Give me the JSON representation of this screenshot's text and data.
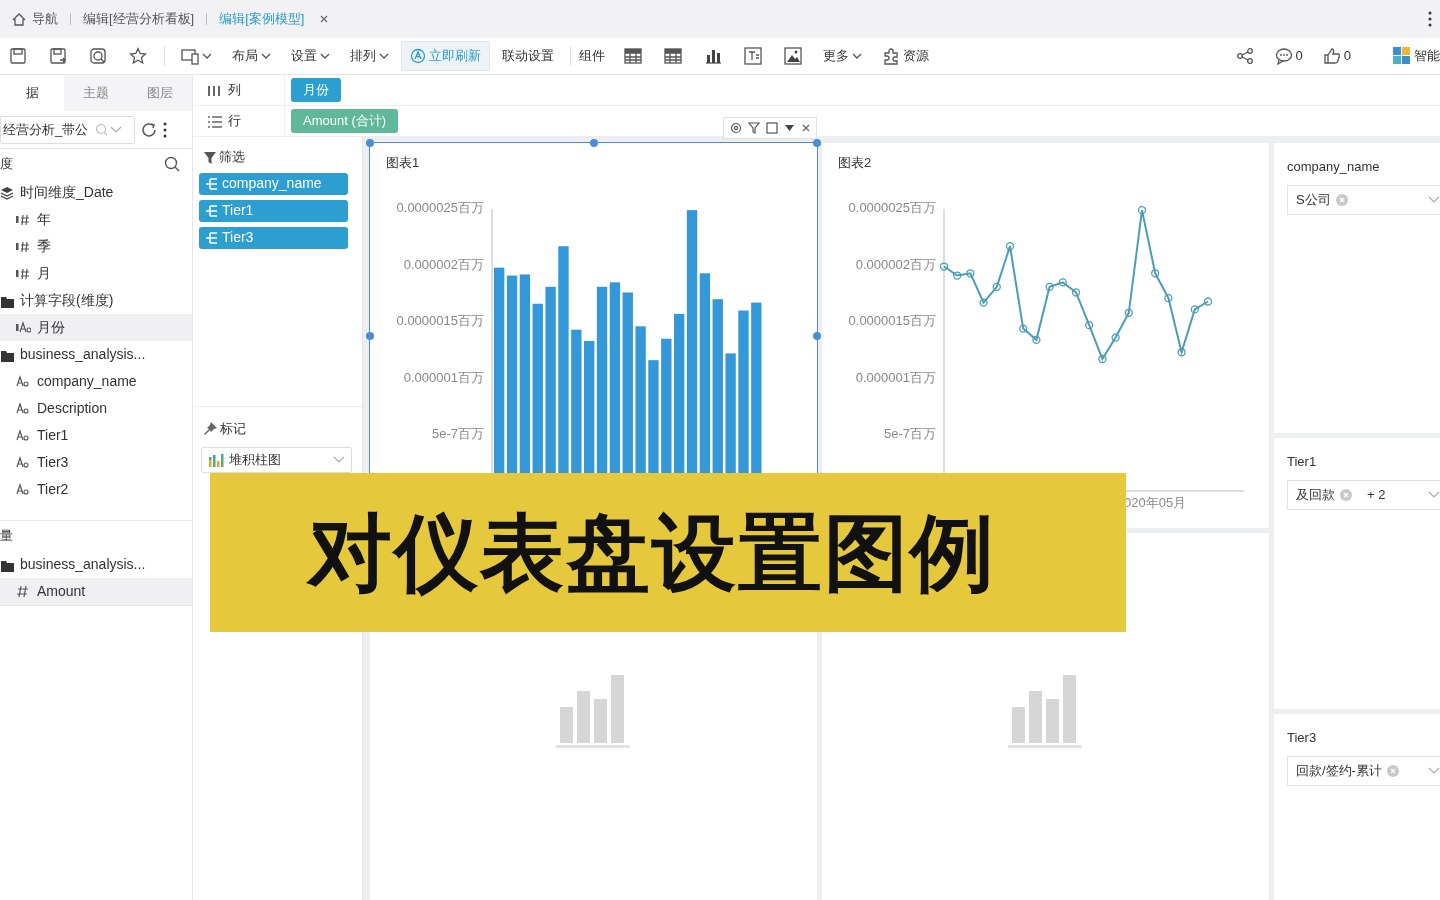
{
  "tabs": [
    {
      "label": "导航",
      "kind": "home",
      "selected": false,
      "closable": false
    },
    {
      "label": "编辑[经营分析看板]",
      "kind": "page",
      "selected": false,
      "closable": false
    },
    {
      "label": "编辑[案例模型]",
      "kind": "page",
      "selected": true,
      "closable": true
    }
  ],
  "toolbar": {
    "menus": [
      "布局",
      "设置",
      "排列"
    ],
    "refresh_button": "立即刷新",
    "link_settings": "联动设置",
    "components_label": "组件",
    "more_menu": "更多",
    "resources": "资源",
    "comments_count": "0",
    "likes_count": "0",
    "smart_label": "智能"
  },
  "left_panel": {
    "tabs": [
      {
        "label": "据",
        "selected": true
      },
      {
        "label": "主题",
        "selected": false
      },
      {
        "label": "图层",
        "selected": false
      }
    ],
    "search_value": "经营分析_带公",
    "sections": [
      {
        "title": "度",
        "tree": [
          {
            "label": "时间维度_Date",
            "kind": "hierarchy",
            "selected": false,
            "children": [
              {
                "label": "年",
                "kind": "date",
                "selected": false
              },
              {
                "label": "季",
                "kind": "date",
                "selected": false
              },
              {
                "label": "月",
                "kind": "date",
                "selected": false
              }
            ]
          },
          {
            "label": "计算字段(维度)",
            "kind": "folder",
            "selected": false,
            "children": [
              {
                "label": "月份",
                "kind": "calc",
                "selected": true
              }
            ]
          },
          {
            "label": "business_analysis...",
            "kind": "folder",
            "selected": false,
            "children": [
              {
                "label": "company_name",
                "kind": "text",
                "selected": false
              },
              {
                "label": "Description",
                "kind": "text",
                "selected": false
              },
              {
                "label": "Tier1",
                "kind": "text",
                "selected": false
              },
              {
                "label": "Tier3",
                "kind": "text",
                "selected": false
              },
              {
                "label": "Tier2",
                "kind": "text",
                "selected": false
              }
            ]
          }
        ]
      },
      {
        "title": "量",
        "tree": [
          {
            "label": "business_analysis...",
            "kind": "folder",
            "selected": false,
            "children": [
              {
                "label": "Amount",
                "kind": "number",
                "selected": true
              }
            ]
          }
        ]
      }
    ]
  },
  "shelves": [
    {
      "label": "列",
      "kind": "columns",
      "pills": [
        {
          "label": "月份",
          "kind": "dimension"
        }
      ]
    },
    {
      "label": "行",
      "kind": "rows",
      "pills": [
        {
          "label": "Amount (合计)",
          "kind": "measure"
        }
      ]
    }
  ],
  "filters": {
    "title": "筛选",
    "pills": [
      "company_name",
      "Tier1",
      "Tier3"
    ]
  },
  "marks": {
    "title": "标记",
    "chart_type": "堆积柱图"
  },
  "charts": [
    {
      "title": "图表1",
      "selected": true,
      "chart_data": {
        "type": "bar",
        "ylim": [
          0,
          2.5e-06
        ],
        "yticks": [
          {
            "value": 5e-07,
            "label": "5e-7百万"
          },
          {
            "value": 1e-06,
            "label": "0.000001百万"
          },
          {
            "value": 1.5e-06,
            "label": "0.0000015百万"
          },
          {
            "value": 2e-06,
            "label": "0.000002百万"
          },
          {
            "value": 2.5e-06,
            "label": "0.0000025百万"
          }
        ],
        "series": [
          {
            "color": "#3498d8",
            "values": [
              1.98e-06,
              1.91e-06,
              1.92e-06,
              1.66e-06,
              1.81e-06,
              2.17e-06,
              1.43e-06,
              1.33e-06,
              1.81e-06,
              1.85e-06,
              1.76e-06,
              1.46e-06,
              1.16e-06,
              1.35e-06,
              1.57e-06,
              2.49e-06,
              1.93e-06,
              1.7e-06,
              1.22e-06,
              1.6e-06,
              1.67e-06
            ]
          }
        ]
      }
    },
    {
      "title": "图表2",
      "selected": false,
      "axis_text": "020年05月",
      "chart_data": {
        "type": "line",
        "ylim": [
          0,
          2.5e-06
        ],
        "yticks": [
          {
            "value": 5e-07,
            "label": "5e-7百万"
          },
          {
            "value": 1e-06,
            "label": "0.000001百万"
          },
          {
            "value": 1.5e-06,
            "label": "0.0000015百万"
          },
          {
            "value": 2e-06,
            "label": "0.000002百万"
          },
          {
            "value": 2.5e-06,
            "label": "0.0000025百万"
          }
        ],
        "series": [
          {
            "color": "#4a9db5",
            "marker": "circle",
            "values": [
              1.99e-06,
              1.91e-06,
              1.93e-06,
              1.67e-06,
              1.81e-06,
              2.17e-06,
              1.44e-06,
              1.34e-06,
              1.81e-06,
              1.85e-06,
              1.76e-06,
              1.47e-06,
              1.17e-06,
              1.36e-06,
              1.58e-06,
              2.49e-06,
              1.93e-06,
              1.71e-06,
              1.23e-06,
              1.61e-06,
              1.68e-06
            ]
          }
        ]
      }
    }
  ],
  "placeholders": [
    {
      "kind": "empty-chart"
    },
    {
      "kind": "empty-chart"
    }
  ],
  "filter_widgets": [
    {
      "title": "company_name",
      "values": [
        "S公司"
      ]
    },
    {
      "title": "Tier1",
      "values": [
        "及回款"
      ],
      "more": "+ 2"
    },
    {
      "title": "Tier3",
      "values": [
        "回款/签约-累计"
      ]
    }
  ],
  "banner": {
    "text": "对仪表盘设置图例"
  }
}
